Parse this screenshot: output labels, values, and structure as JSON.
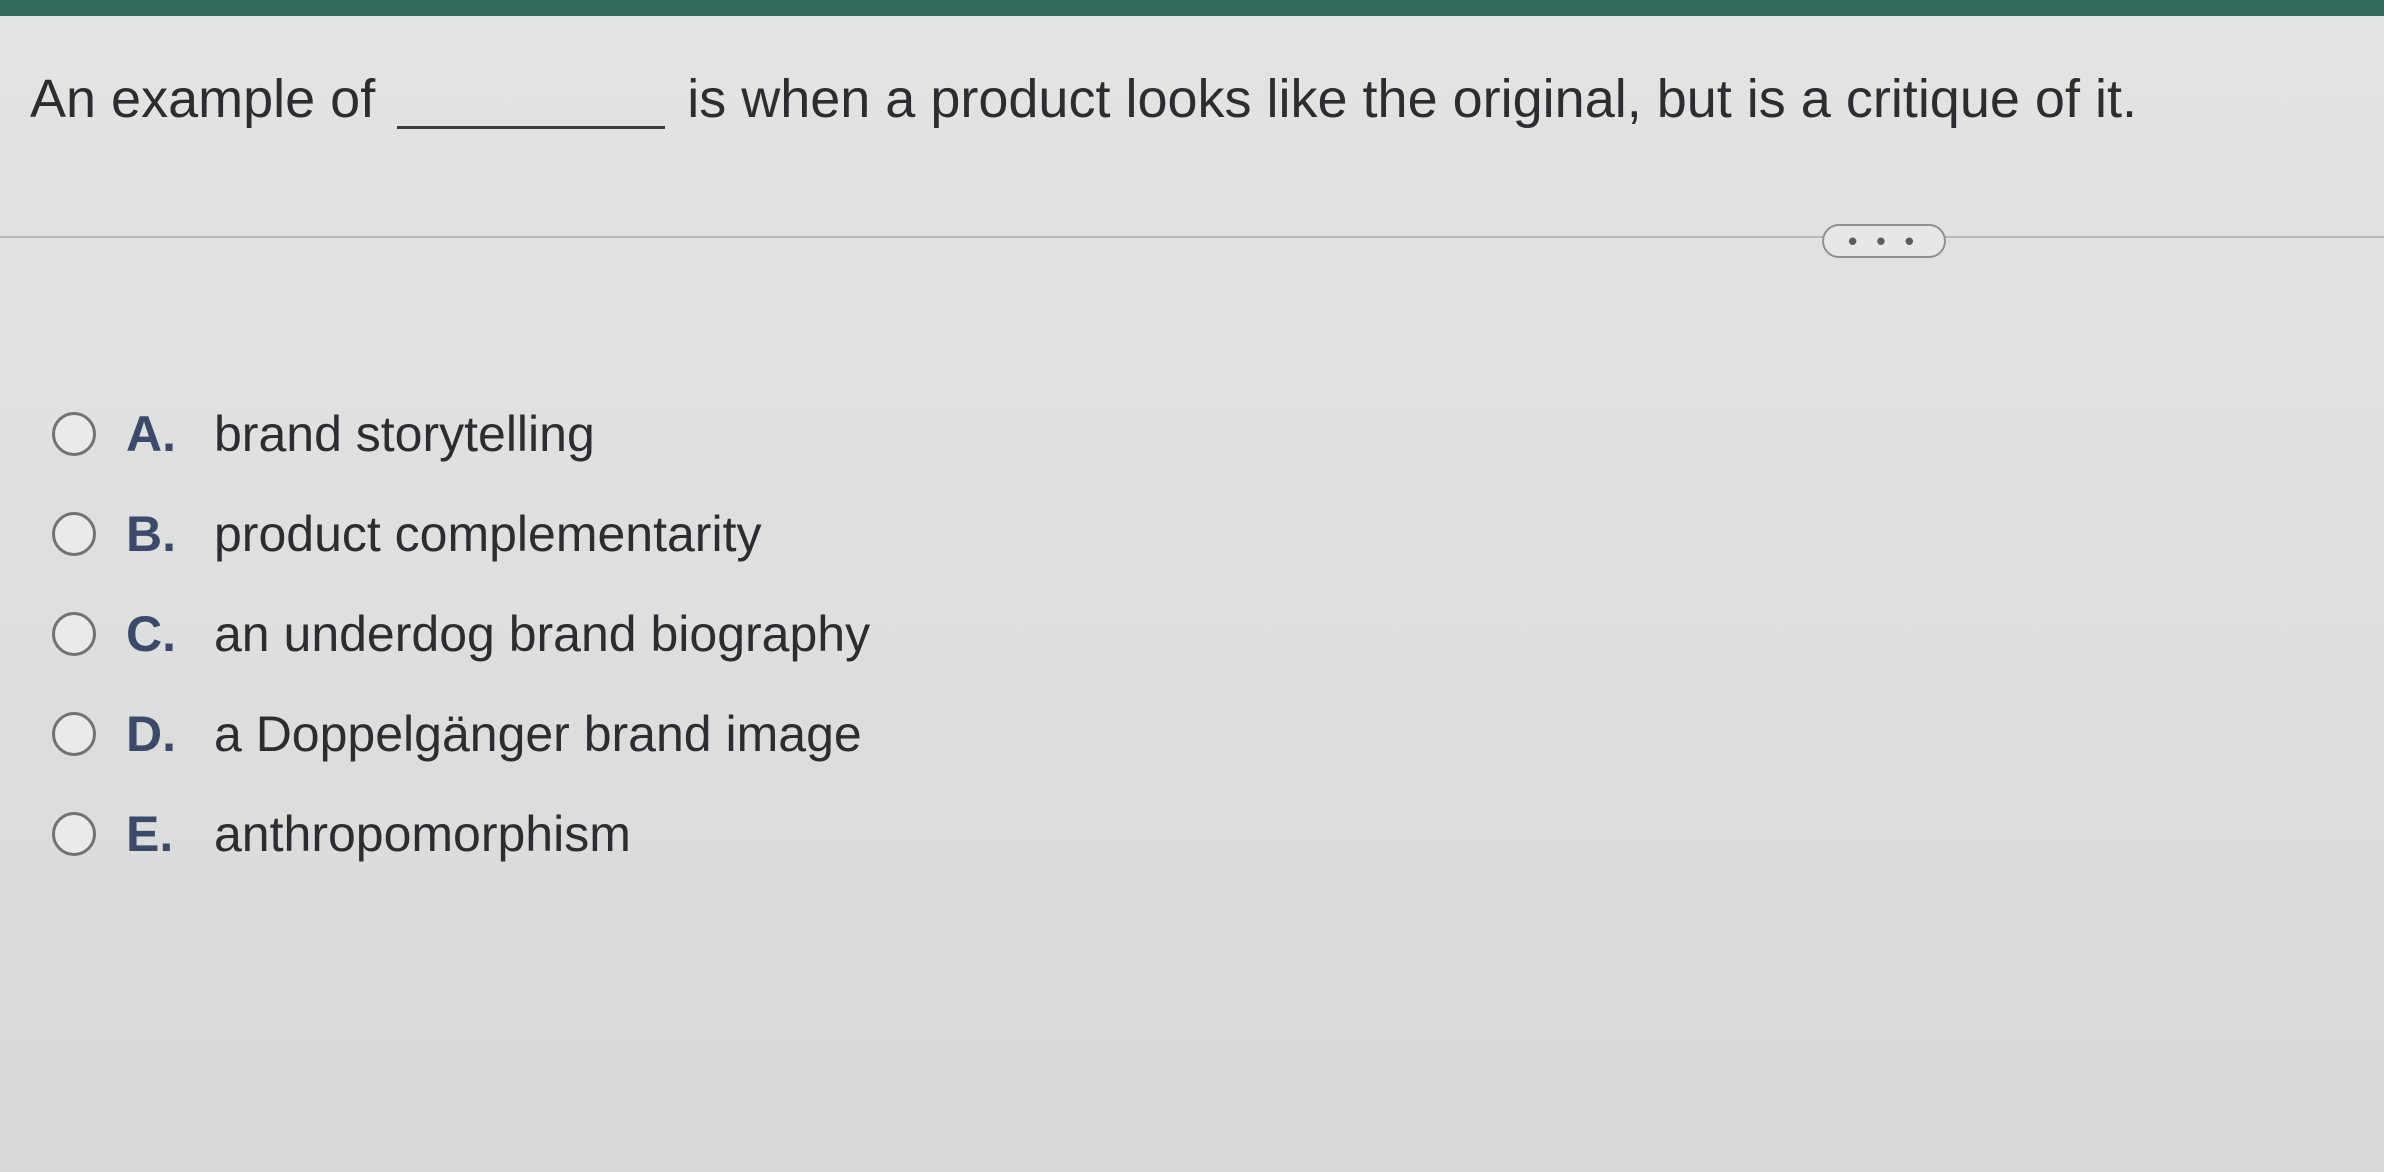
{
  "question": {
    "prefix": "An example of",
    "suffix": "is when a product looks like the original, but is a critique of it."
  },
  "more_button": {
    "label": "• • •"
  },
  "options": [
    {
      "letter": "A.",
      "text": "brand storytelling"
    },
    {
      "letter": "B.",
      "text": "product complementarity"
    },
    {
      "letter": "C.",
      "text": "an underdog brand biography"
    },
    {
      "letter": "D.",
      "text": "a Doppelgänger brand image"
    },
    {
      "letter": "E.",
      "text": "anthropomorphism"
    }
  ],
  "colors": {
    "top_bar": "#2f6a5c",
    "option_letter": "#3b4a6b",
    "text": "#2b2d30"
  }
}
